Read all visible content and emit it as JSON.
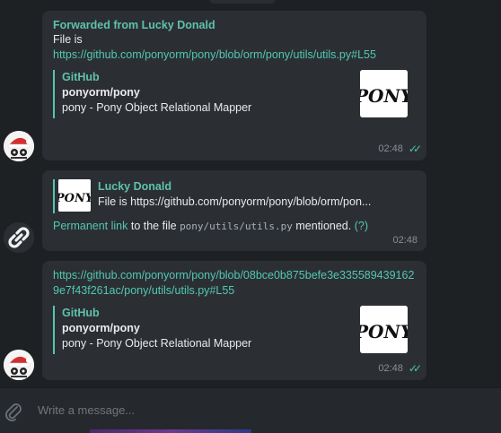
{
  "messages": [
    {
      "forwarded_from": "Forwarded from Lucky Donald",
      "text_prefix": "File is",
      "link": "https://github.com/ponyorm/pony/blob/orm/pony/utils/utils.py#L55",
      "preview": {
        "site": "GitHub",
        "title": "ponyorm/pony",
        "description": "pony - Pony Object Relational Mapper",
        "thumb_text": "PONY"
      },
      "time": "02:48",
      "ticks": "✓✓"
    },
    {
      "reply": {
        "name": "Lucky Donald",
        "text": "File is https://github.com/ponyorm/pony/blob/orm/pon..."
      },
      "link_text": "Permanent link",
      "mid_text": " to the file ",
      "code": "pony/utils/utils.py",
      "end_text": " mentioned. ",
      "help": "(?)",
      "time": "02:48"
    },
    {
      "link": "https://github.com/ponyorm/pony/blob/08bce0b875befe3e3355894391629e7f43f261ac/pony/utils/utils.py#L55",
      "preview": {
        "site": "GitHub",
        "title": "ponyorm/pony",
        "description": "pony - Pony Object Relational Mapper",
        "thumb_text": "PONY"
      },
      "time": "02:48",
      "ticks": "✓✓"
    }
  ],
  "composer": {
    "placeholder": "Write a message..."
  },
  "colors": {
    "background": "#1e2124",
    "bubble": "#2b2f34",
    "accent": "#53c7b0"
  },
  "icons": {
    "avatar_user": "santa-avatar-icon",
    "avatar_bot": "link-icon",
    "attach": "paperclip-icon",
    "read": "double-check-icon"
  }
}
